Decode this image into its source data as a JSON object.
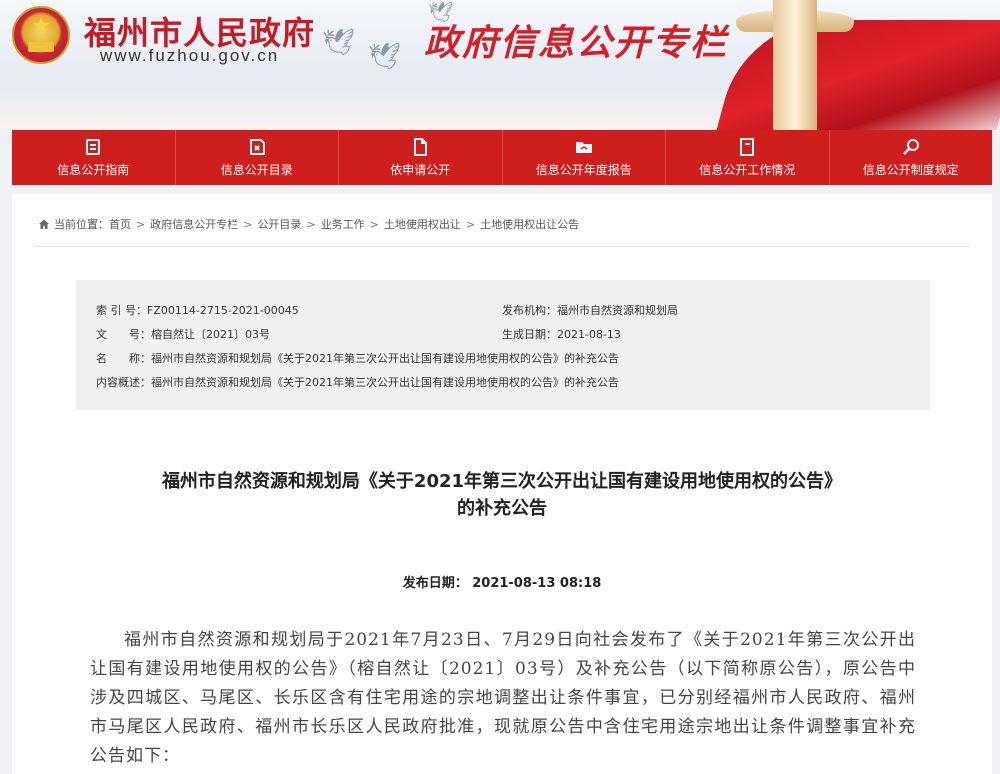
{
  "header": {
    "site_name": "福州市人民政府",
    "site_url": "www.fuzhou.gov.cn",
    "column_title": "政府信息公开专栏"
  },
  "nav": {
    "items": [
      {
        "label": "信息公开指南",
        "icon": "guide-icon"
      },
      {
        "label": "信息公开目录",
        "icon": "catalog-icon"
      },
      {
        "label": "依申请公开",
        "icon": "document-icon"
      },
      {
        "label": "信息公开年度报告",
        "icon": "report-icon"
      },
      {
        "label": "信息公开工作情况",
        "icon": "notebook-icon"
      },
      {
        "label": "信息公开制度规定",
        "icon": "search-icon"
      }
    ]
  },
  "breadcrumb": {
    "prefix": "当前位置：",
    "items": [
      "首页",
      "政府信息公开专栏",
      "公开目录",
      "业务工作",
      "土地使用权出让",
      "土地使用权出让公告"
    ]
  },
  "meta": {
    "index_label": "索 引 号：",
    "index_value": "FZ00114-2715-2021-00045",
    "publisher_label": "发布机构：",
    "publisher_value": "福州市自然资源和规划局",
    "docno_label": "文　　号：",
    "docno_value": "榕自然让〔2021〕03号",
    "created_label": "生成日期：",
    "created_value": "2021-08-13",
    "name_label": "名　　称：",
    "name_value": "福州市自然资源和规划局《关于2021年第三次公开出让国有建设用地使用权的公告》的补充公告",
    "summary_label": "内容概述：",
    "summary_value": "福州市自然资源和规划局《关于2021年第三次公开出让国有建设用地使用权的公告》的补充公告"
  },
  "article": {
    "title_line1": "福州市自然资源和规划局《关于2021年第三次公开出让国有建设用地使用权的公告》",
    "title_line2": "的补充公告",
    "date_label": "发布日期：",
    "date_value": "2021-08-13 08:18",
    "body": "福州市自然资源和规划局于2021年7月23日、7月29日向社会发布了《关于2021年第三次公开出让国有建设用地使用权的公告》（榕自然让〔2021〕03号）及补充公告（以下简称原公告），原公告中涉及四城区、马尾区、长乐区含有住宅用途的宗地调整出让条件事宜，已分别经福州市人民政府、福州市马尾区人民政府、福州市长乐区人民政府批准，现就原公告中含住宅用途宗地出让条件调整事宜补充公告如下："
  },
  "colors": {
    "brand_red": "#cf1e1e",
    "title_red": "#c31d23"
  }
}
